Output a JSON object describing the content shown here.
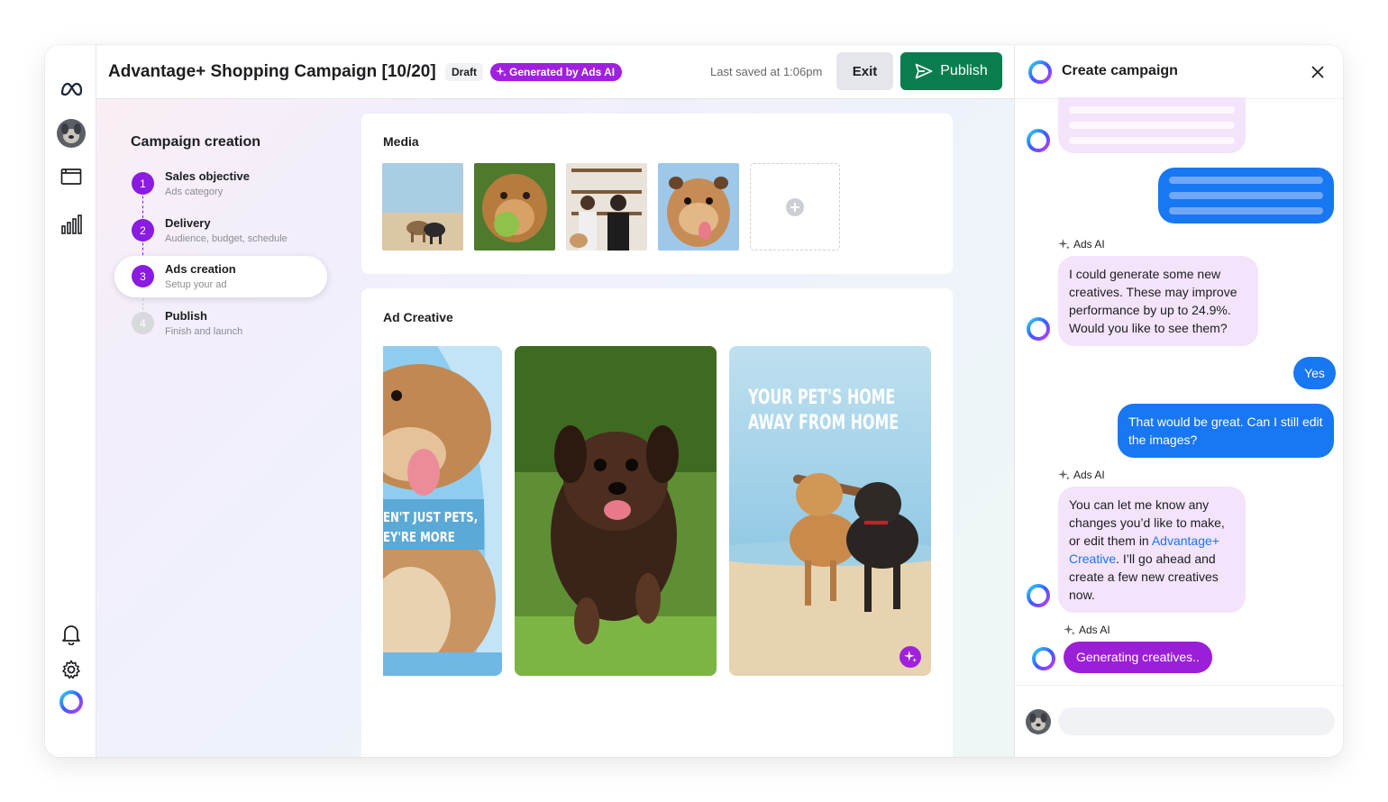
{
  "header": {
    "title": "Advantage+ Shopping Campaign [10/20]",
    "draft_badge": "Draft",
    "ai_badge": "Generated by Ads AI",
    "last_saved": "Last saved at 1:06pm",
    "exit_label": "Exit",
    "publish_label": "Publish"
  },
  "sidebar": {
    "icons": [
      "meta-logo-icon",
      "avatar",
      "folder-icon",
      "bar-chart-icon",
      "bell-icon",
      "gear-icon",
      "meta-ai-icon"
    ]
  },
  "steps": {
    "title": "Campaign creation",
    "items": [
      {
        "num": "1",
        "name": "Sales objective",
        "sub": "Ads category",
        "state": "done"
      },
      {
        "num": "2",
        "name": "Delivery",
        "sub": "Audience, budget, schedule",
        "state": "done"
      },
      {
        "num": "3",
        "name": "Ads creation",
        "sub": "Setup your ad",
        "state": "active"
      },
      {
        "num": "4",
        "name": "Publish",
        "sub": "Finish and launch",
        "state": "pending"
      }
    ]
  },
  "media": {
    "title": "Media",
    "thumbnails": [
      "dogs-on-beach",
      "dog-with-ball",
      "people-with-dog",
      "bulldog"
    ]
  },
  "ad_creative": {
    "title": "Ad Creative",
    "creatives": [
      {
        "image": "bulldog-tongue",
        "overlay_line1": "EN'T JUST PETS,",
        "overlay_line2": "EY'RE MORE"
      },
      {
        "image": "running-puppy"
      },
      {
        "image": "dogs-with-stick",
        "overlay_line1": "YOUR PET'S HOME",
        "overlay_line2": "AWAY FROM HOME"
      }
    ]
  },
  "chat": {
    "title": "Create campaign",
    "ai_name": "Ads AI",
    "msg1_part1": "I could generate some new creatives. These may improve performance by up to 24.9%. Would you like to see them?",
    "user_yes": "Yes",
    "user_msg": "That would be great. Can I still edit the images?",
    "msg2_part1": "You can let me know any changes you’d like to make, or edit them in ",
    "msg2_link": "Advantage+ Creative",
    "msg2_part2": ". I’ll go ahead and create a few new creatives now.",
    "generating": "Generating creatives..",
    "input_placeholder": ""
  },
  "colors": {
    "accent_purple": "#8a1be0",
    "publish_green": "#0a7d4f",
    "messenger_blue": "#1877f2",
    "ai_bubble": "#f3e3fb"
  }
}
